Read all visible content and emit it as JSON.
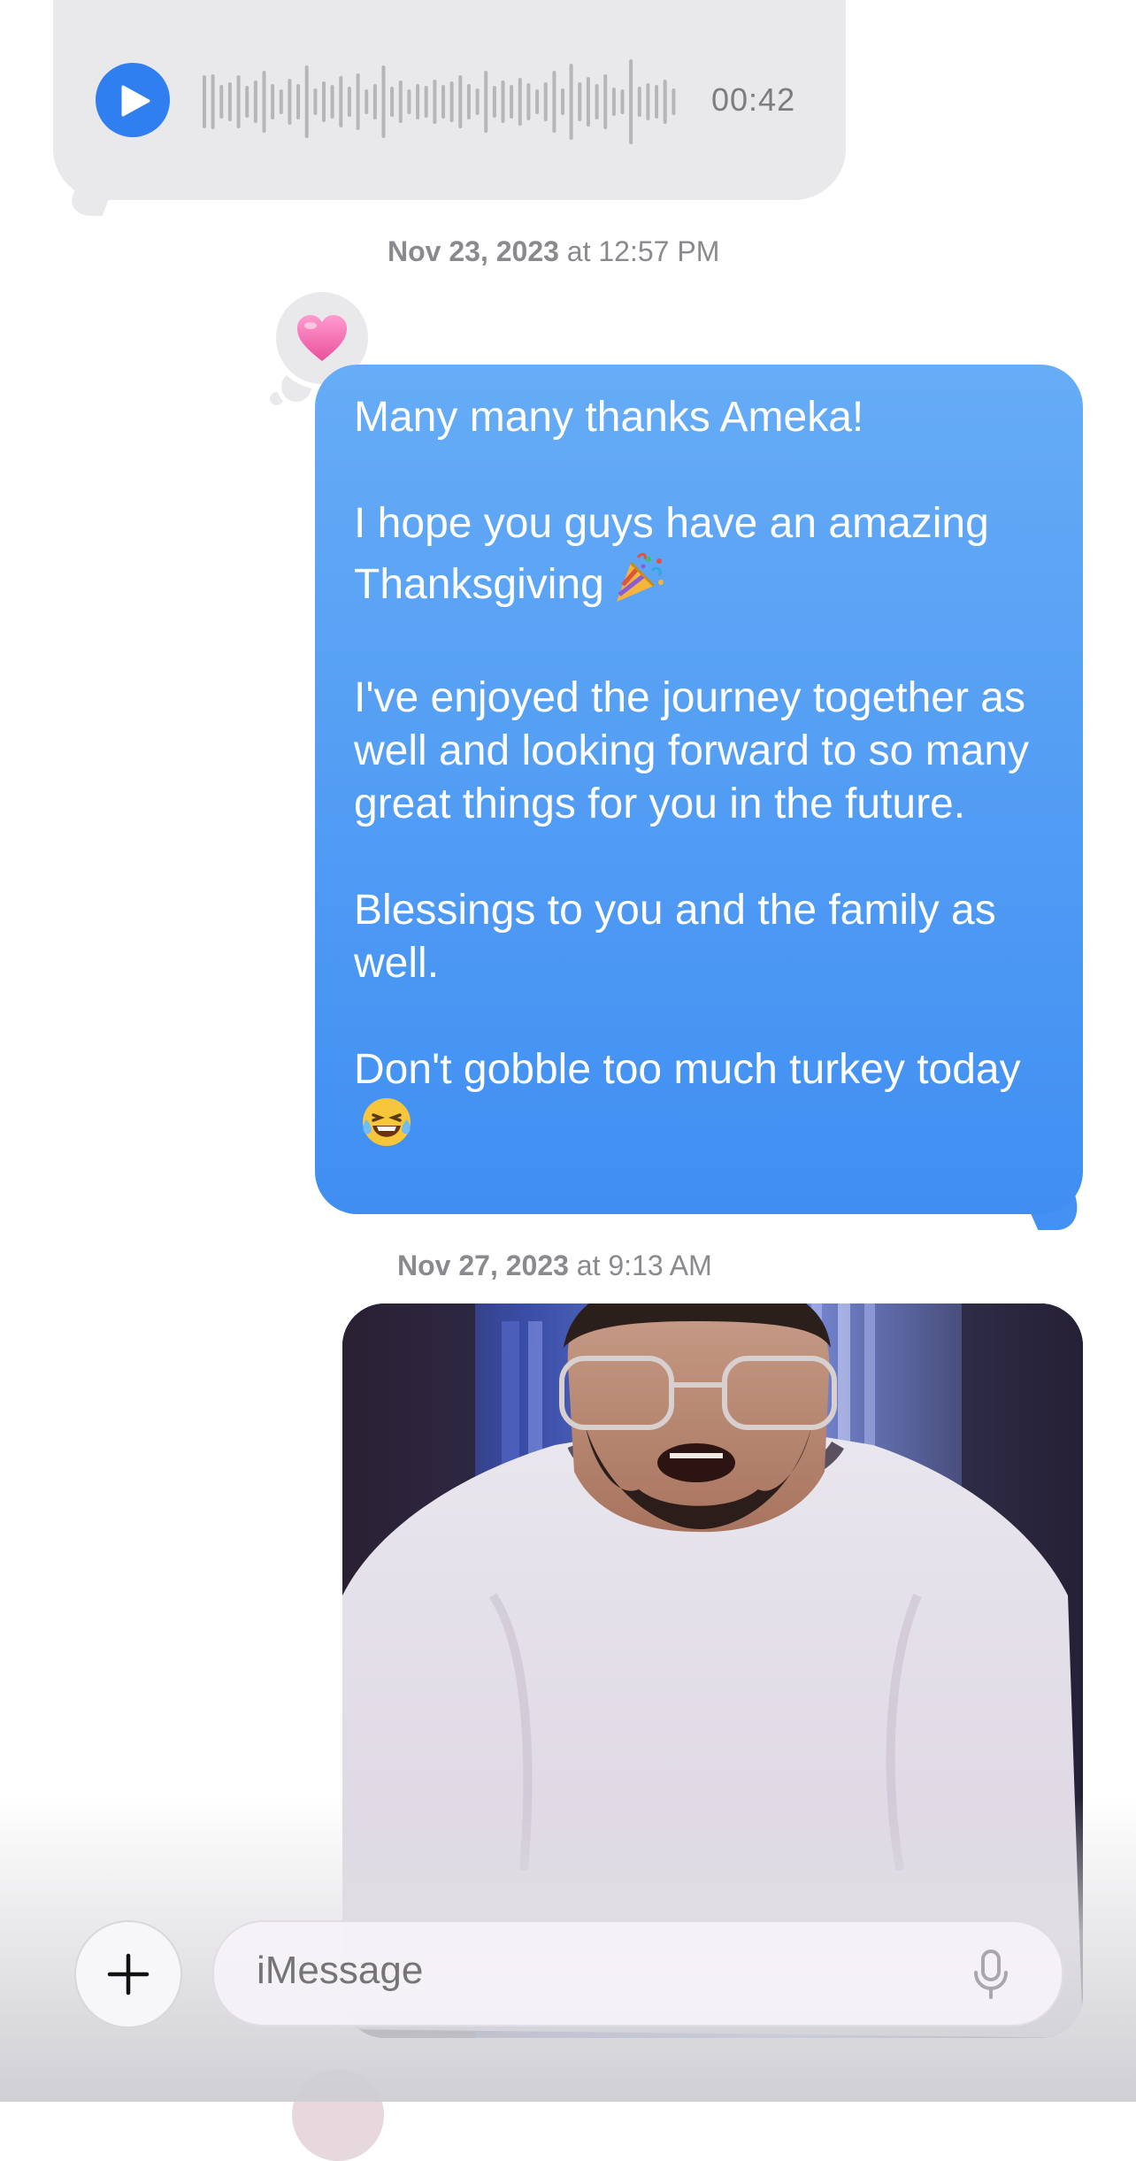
{
  "voice_message": {
    "duration": "00:42",
    "icon": "play-icon",
    "accent": "#2f7ff0"
  },
  "timestamps": [
    {
      "date": "Nov 23, 2023",
      "time": "at 12:57 PM"
    },
    {
      "date": "Nov 27, 2023",
      "time": "at 9:13 AM"
    }
  ],
  "tapback": {
    "icon": "heart-icon",
    "color": "#f06ba8"
  },
  "outgoing_message": {
    "paragraphs": [
      "Many many thanks Ameka!",
      "I hope you guys have an amazing Thanksgiving",
      "I've enjoyed the journey together as well and looking forward to so many great things for you in the future.",
      "Blessings to you and the family as well.",
      "Don't gobble too much turkey today"
    ],
    "emoji": [
      "party-popper-icon",
      "tears-of-joy-icon"
    ],
    "bubble_color": "#4a94f4"
  },
  "gif": {
    "icon": "animated-gif-image"
  },
  "composer": {
    "placeholder": "iMessage",
    "add_icon": "plus-icon",
    "mic_icon": "microphone-icon"
  }
}
